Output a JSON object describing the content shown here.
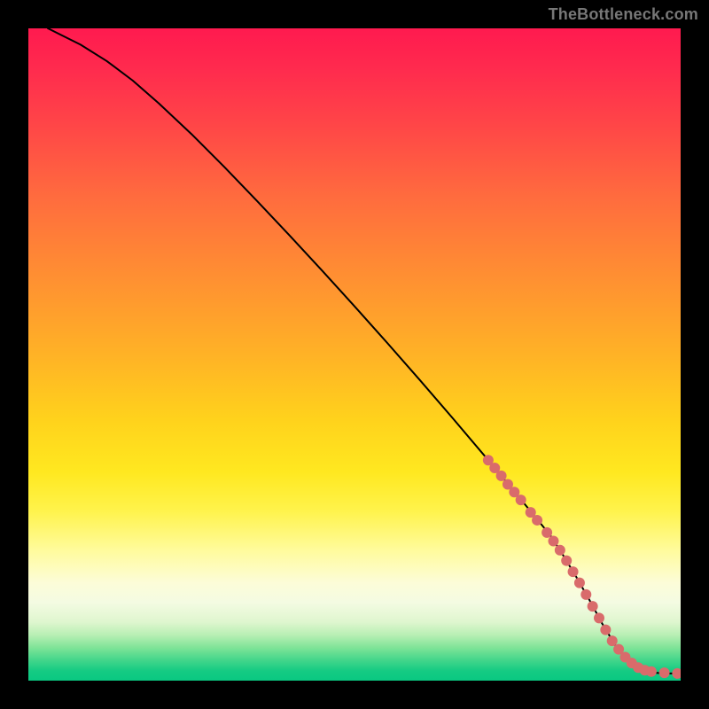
{
  "watermark": "TheBottleneck.com",
  "chart_data": {
    "type": "line",
    "title": "",
    "xlabel": "",
    "ylabel": "",
    "xlim": [
      0,
      100
    ],
    "ylim": [
      0,
      100
    ],
    "grid": false,
    "legend": false,
    "series": [
      {
        "name": "curve",
        "x": [
          3,
          5,
          8,
          12,
          16,
          20,
          25,
          30,
          35,
          40,
          45,
          50,
          55,
          60,
          65,
          70,
          75,
          80,
          82,
          84,
          86,
          88,
          90,
          92,
          94,
          96,
          98,
          100
        ],
        "y": [
          100,
          99,
          97.5,
          95,
          92,
          88.5,
          83.8,
          78.8,
          73.6,
          68.3,
          62.9,
          57.4,
          51.8,
          46.1,
          40.3,
          34.4,
          28.4,
          22.3,
          19.2,
          15.9,
          12.4,
          8.7,
          5.4,
          2.9,
          1.6,
          1.2,
          1.1,
          1.1
        ]
      }
    ],
    "markers": [
      {
        "x": 70.5,
        "y": 33.8
      },
      {
        "x": 71.5,
        "y": 32.6
      },
      {
        "x": 72.5,
        "y": 31.4
      },
      {
        "x": 73.5,
        "y": 30.1
      },
      {
        "x": 74.5,
        "y": 28.9
      },
      {
        "x": 75.5,
        "y": 27.7
      },
      {
        "x": 77.0,
        "y": 25.8
      },
      {
        "x": 78.0,
        "y": 24.6
      },
      {
        "x": 79.5,
        "y": 22.7
      },
      {
        "x": 80.5,
        "y": 21.4
      },
      {
        "x": 81.5,
        "y": 20.0
      },
      {
        "x": 82.5,
        "y": 18.4
      },
      {
        "x": 83.5,
        "y": 16.7
      },
      {
        "x": 84.5,
        "y": 15.0
      },
      {
        "x": 85.5,
        "y": 13.2
      },
      {
        "x": 86.5,
        "y": 11.4
      },
      {
        "x": 87.5,
        "y": 9.6
      },
      {
        "x": 88.5,
        "y": 7.8
      },
      {
        "x": 89.5,
        "y": 6.1
      },
      {
        "x": 90.5,
        "y": 4.8
      },
      {
        "x": 91.5,
        "y": 3.6
      },
      {
        "x": 92.5,
        "y": 2.7
      },
      {
        "x": 93.5,
        "y": 2.0
      },
      {
        "x": 94.5,
        "y": 1.6
      },
      {
        "x": 95.5,
        "y": 1.4
      },
      {
        "x": 97.5,
        "y": 1.2
      },
      {
        "x": 99.5,
        "y": 1.1
      }
    ],
    "marker_radius_px": 6,
    "marker_color": "#d96b6b",
    "curve_color": "#000000",
    "gradient_stops": [
      {
        "pos": 0.0,
        "color": "#ff1a4f"
      },
      {
        "pos": 0.5,
        "color": "#ffb226"
      },
      {
        "pos": 0.8,
        "color": "#fffb9c"
      },
      {
        "pos": 1.0,
        "color": "#0ac881"
      }
    ]
  }
}
